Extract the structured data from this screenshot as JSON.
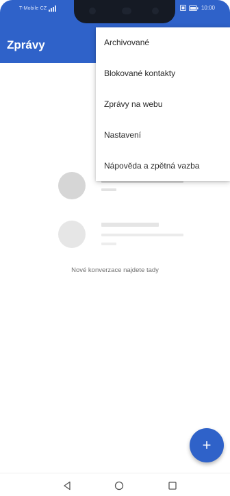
{
  "status_bar": {
    "carrier": "T-Mobile CZ",
    "time": "10:00"
  },
  "app_bar": {
    "title": "Zprávy",
    "background_color": "#2f62c9"
  },
  "overflow_menu": {
    "items": [
      {
        "label": "Archivované"
      },
      {
        "label": "Blokované kontakty"
      },
      {
        "label": "Zprávy na webu"
      },
      {
        "label": "Nastavení"
      },
      {
        "label": "Nápověda a zpětná vazba"
      }
    ]
  },
  "empty_state": {
    "message": "Nové konverzace najdete tady"
  },
  "fab": {
    "icon": "plus-icon",
    "symbol": "+",
    "color": "#2f62c9"
  },
  "nav_bar": {
    "icons": [
      "back-icon",
      "home-icon",
      "recents-icon"
    ]
  }
}
